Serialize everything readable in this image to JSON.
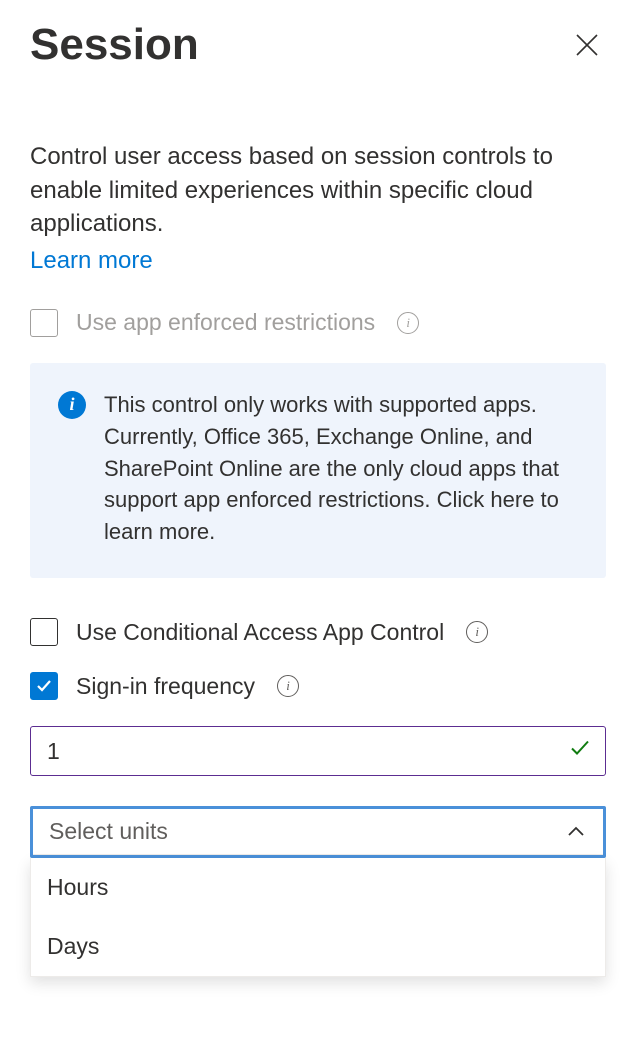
{
  "header": {
    "title": "Session"
  },
  "description": "Control user access based on session controls to enable limited experiences within specific cloud applications.",
  "learn_more": "Learn more",
  "options": {
    "app_enforced": {
      "label": "Use app enforced restrictions",
      "checked": false,
      "disabled": true
    },
    "conditional_access": {
      "label": "Use Conditional Access App Control",
      "checked": false
    },
    "signin_frequency": {
      "label": "Sign-in frequency",
      "checked": true
    }
  },
  "info_box": {
    "text": "This control only works with supported apps. Currently, Office 365, Exchange Online, and SharePoint Online are the only cloud apps that support app enforced restrictions. Click here to learn more."
  },
  "frequency_input": {
    "value": "1"
  },
  "units_select": {
    "placeholder": "Select units",
    "options": [
      "Hours",
      "Days"
    ]
  }
}
